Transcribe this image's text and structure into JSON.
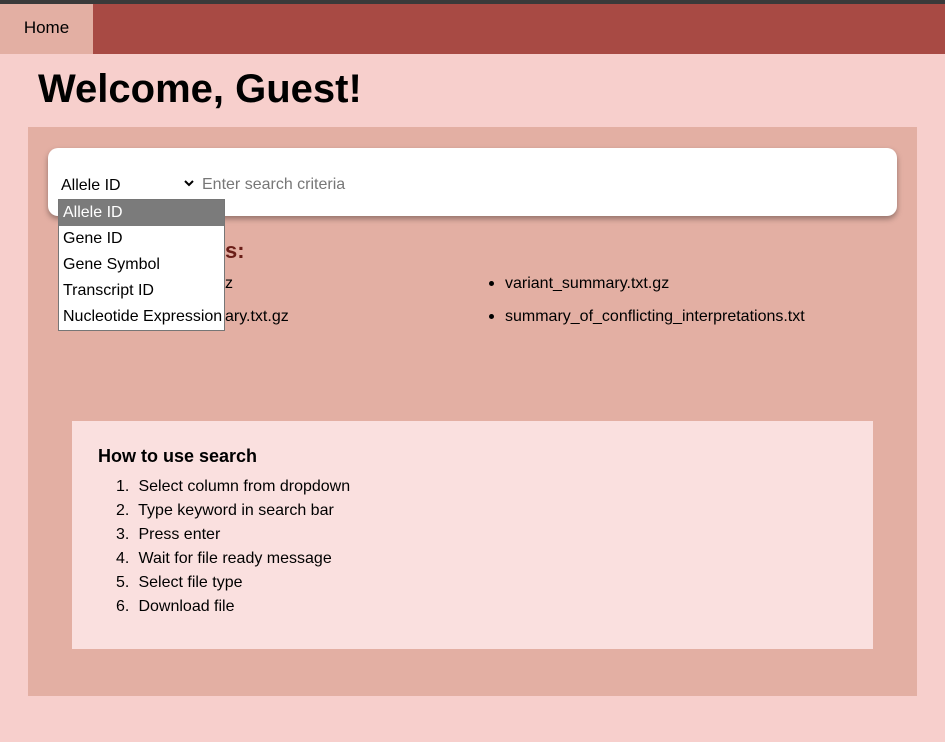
{
  "nav": {
    "home_label": "Home"
  },
  "page": {
    "title": "Welcome, Guest!"
  },
  "search": {
    "selected_column": "Allele ID",
    "placeholder": "Enter search criteria",
    "value": "",
    "options": [
      "Allele ID",
      "Gene ID",
      "Gene Symbol",
      "Transcript ID",
      "Nucleotide Expression"
    ]
  },
  "files": {
    "heading_visible_fragment": "s:",
    "items": [
      {
        "visible_text": "z"
      },
      {
        "visible_text": "variant_summary.txt.gz"
      },
      {
        "visible_text": "ary.txt.gz"
      },
      {
        "visible_text": "summary_of_conflicting_interpretations.txt"
      }
    ]
  },
  "howto": {
    "title": "How to use search",
    "steps": [
      "Select column from dropdown",
      "Type keyword in search bar",
      "Press enter",
      "Wait for file ready message",
      "Select file type",
      "Download file"
    ]
  },
  "colors": {
    "background": "#f7cfcc",
    "navbar": "#a84a44",
    "panel": "#e3afa3",
    "howto_card": "#fae0df",
    "heading_accent": "#6a1e18",
    "selected_option": "#7b7b7b"
  }
}
